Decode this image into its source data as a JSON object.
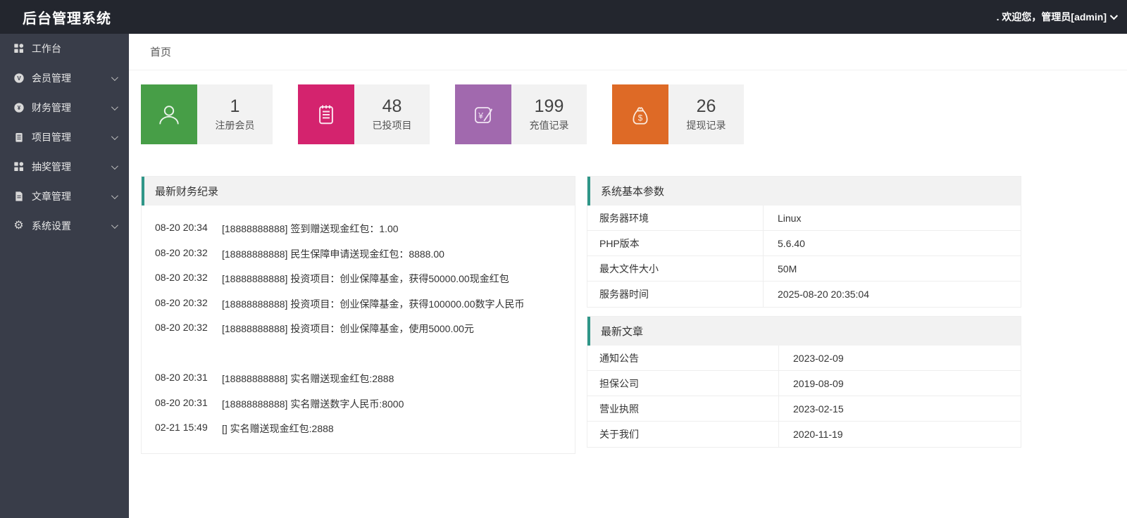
{
  "app": {
    "title": "后台管理系统",
    "welcome": ". 欢迎您，管理员[admin]"
  },
  "breadcrumb": {
    "home": "首页"
  },
  "colors": {
    "topbar": "#23262e",
    "sidebar": "#393d49",
    "accent": "#2f9688",
    "card_green": "#479e47",
    "card_pink": "#d4236e",
    "card_purple": "#a169ae",
    "card_orange": "#de6a26"
  },
  "sidebar": {
    "items": [
      {
        "label": "工作台",
        "icon": "grid-icon",
        "expandable": false
      },
      {
        "label": "会员管理",
        "icon": "member-badge-icon",
        "expandable": true
      },
      {
        "label": "财务管理",
        "icon": "yuan-circle-icon",
        "expandable": true
      },
      {
        "label": "项目管理",
        "icon": "clipboard-icon",
        "expandable": true
      },
      {
        "label": "抽奖管理",
        "icon": "grid-icon",
        "expandable": true
      },
      {
        "label": "文章管理",
        "icon": "document-icon",
        "expandable": true
      },
      {
        "label": "系统设置",
        "icon": "gear-icon",
        "expandable": true
      }
    ]
  },
  "cards": [
    {
      "value": "1",
      "label": "注册会员",
      "color": "#479e47",
      "icon": "user-icon"
    },
    {
      "value": "48",
      "label": "已投项目",
      "color": "#d4236e",
      "icon": "clipboard-icon"
    },
    {
      "value": "199",
      "label": "充值记录",
      "color": "#a169ae",
      "icon": "yuan-edit-icon"
    },
    {
      "value": "26",
      "label": "提现记录",
      "color": "#de6a26",
      "icon": "money-bag-icon"
    }
  ],
  "finance": {
    "title": "最新财务纪录",
    "records": [
      {
        "time": "08-20 20:34",
        "text": "[18888888888] 签到赠送现金红包：1.00"
      },
      {
        "time": "08-20 20:32",
        "text": "[18888888888] 民生保障申请送现金红包：8888.00"
      },
      {
        "time": "08-20 20:32",
        "text": "[18888888888] 投资项目：创业保障基金，获得50000.00现金红包"
      },
      {
        "time": "08-20 20:32",
        "text": "[18888888888] 投资项目：创业保障基金，获得100000.00数字人民币"
      },
      {
        "time": "08-20 20:32",
        "text": "[18888888888] 投资项目：创业保障基金，使用5000.00元"
      },
      {
        "time": "",
        "text": ""
      },
      {
        "time": "08-20 20:31",
        "text": "[18888888888] 实名赠送现金红包:2888"
      },
      {
        "time": "08-20 20:31",
        "text": "[18888888888] 实名赠送数字人民币:8000"
      },
      {
        "time": "02-21 15:49",
        "text": "[] 实名赠送现金红包:2888"
      }
    ]
  },
  "sysinfo": {
    "title": "系统基本参数",
    "rows": [
      {
        "label": "服务器环境",
        "value": "Linux"
      },
      {
        "label": "PHP版本",
        "value": "5.6.40"
      },
      {
        "label": "最大文件大小",
        "value": "50M"
      },
      {
        "label": "服务器时间",
        "value": "2025-08-20 20:35:04"
      }
    ]
  },
  "articles": {
    "title": "最新文章",
    "rows": [
      {
        "title": "通知公告",
        "date": "2023-02-09"
      },
      {
        "title": "担保公司",
        "date": "2019-08-09"
      },
      {
        "title": "营业执照",
        "date": "2023-02-15"
      },
      {
        "title": "关于我们",
        "date": "2020-11-19"
      }
    ]
  }
}
